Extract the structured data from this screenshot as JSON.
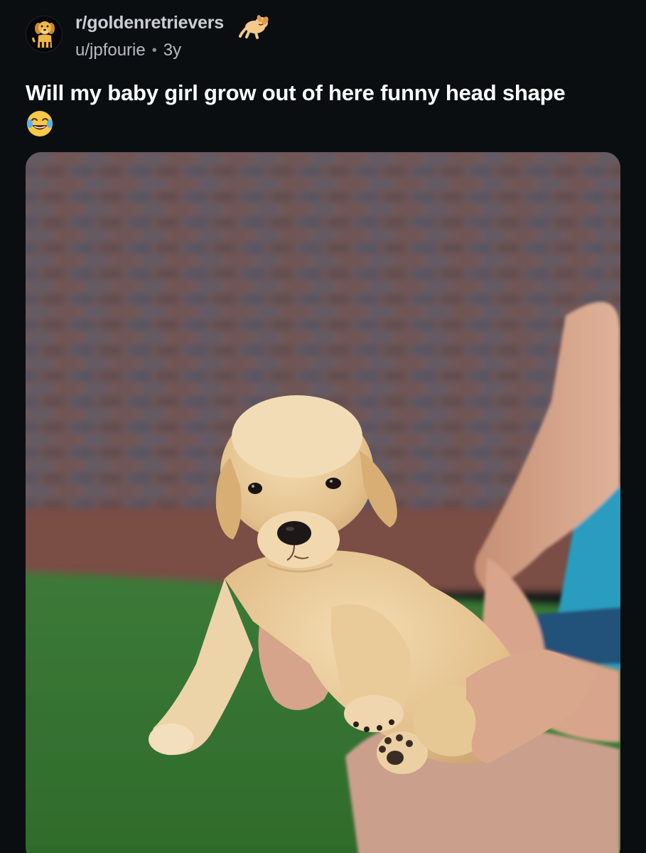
{
  "post": {
    "subreddit": "r/goldenretrievers",
    "author": "u/jpfourie",
    "separator": "•",
    "age": "3y",
    "title": "Will my baby girl grow out of here funny head shape",
    "title_emoji": "face-with-tears-of-joy-icon",
    "subreddit_icon": "golden-retriever-icon",
    "flair_icon": "sleeping-dog-icon",
    "media": {
      "icon": "puppy-photo",
      "description_hidden": true
    }
  },
  "colors": {
    "background": "#0b0e11",
    "title": "#ffffff",
    "meta": "#b6bcc2",
    "subreddit": "#c9cfd4"
  }
}
